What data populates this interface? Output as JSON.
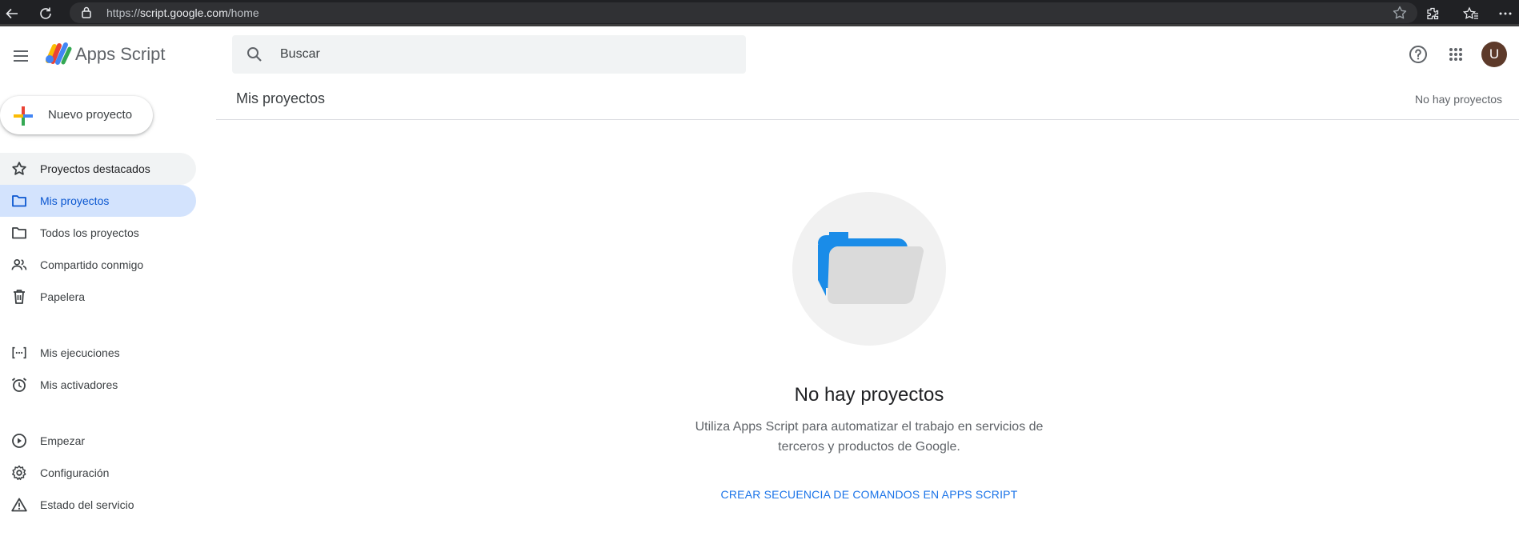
{
  "browser": {
    "url_scheme": "https://",
    "url_host": "script.google.com",
    "url_path": "/home"
  },
  "header": {
    "app_title": "Apps Script",
    "avatar_letter": "U",
    "icons": [
      "menu-icon",
      "help-icon",
      "apps-grid-icon"
    ]
  },
  "search": {
    "placeholder": "Buscar"
  },
  "sidebar": {
    "new_project_label": "Nuevo proyecto",
    "items": [
      {
        "label": "Proyectos destacados",
        "icon": "star-icon"
      },
      {
        "label": "Mis proyectos",
        "icon": "folder-icon"
      },
      {
        "label": "Todos los proyectos",
        "icon": "folder-icon"
      },
      {
        "label": "Compartido conmigo",
        "icon": "people-icon"
      },
      {
        "label": "Papelera",
        "icon": "trash-icon"
      },
      {
        "label": "Mis ejecuciones",
        "icon": "executions-icon"
      },
      {
        "label": "Mis activadores",
        "icon": "alarm-icon"
      },
      {
        "label": "Empezar",
        "icon": "play-circle-icon"
      },
      {
        "label": "Configuración",
        "icon": "gear-icon"
      },
      {
        "label": "Estado del servicio",
        "icon": "warning-icon"
      }
    ]
  },
  "main": {
    "title": "Mis proyectos",
    "count_text": "No hay proyectos",
    "empty_title": "No hay proyectos",
    "empty_desc_line1": "Utiliza Apps Script para automatizar el trabajo en servicios de",
    "empty_desc_line2": "terceros y productos de Google.",
    "create_link": "CREAR SECUENCIA DE COMANDOS EN APPS SCRIPT"
  },
  "colors": {
    "active_bg": "#d3e3fd",
    "active_text": "#0b57d0",
    "link": "#1a73e8",
    "folder_blue": "#1a8ce8"
  }
}
